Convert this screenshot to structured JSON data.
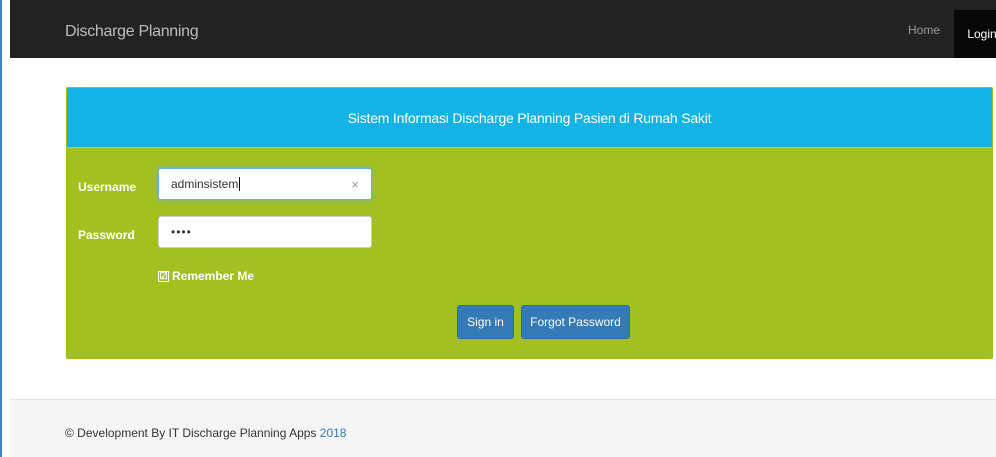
{
  "navbar": {
    "brand": "Discharge Planning",
    "home_label": "Home",
    "login_label": "Login"
  },
  "panel": {
    "heading": "Sistem Informasi Discharge Planning Pasien di Rumah Sakit"
  },
  "form": {
    "username_label": "Username",
    "username_value": "adminsistem",
    "password_label": "Password",
    "password_display": "••••",
    "remember_label": "Remember Me",
    "remember_checked": "☑",
    "sign_in_label": "Sign in",
    "forgot_label": "Forgot Password",
    "clear_glyph": "×"
  },
  "footer": {
    "text": "© Development By IT Discharge Planning Apps",
    "year": "2018"
  },
  "colors": {
    "navbar_bg": "#222222",
    "heading_bg": "#14b3e6",
    "panel_body_bg": "#a2c020",
    "button_bg": "#337ab7"
  }
}
